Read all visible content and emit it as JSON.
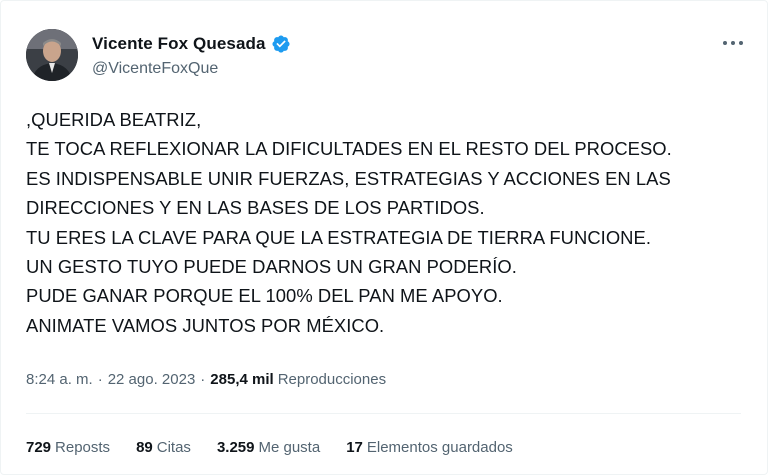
{
  "author": {
    "display_name": "Vicente Fox Quesada",
    "handle": "@VicenteFoxQue",
    "verified_icon": "verified-badge-icon",
    "avatar_icon": "avatar"
  },
  "menu": {
    "icon": "more-options-icon"
  },
  "tweet": {
    "lines": [
      ",QUERIDA BEATRIZ,",
      "TE TOCA REFLEXIONAR LA DIFICULTADES EN EL RESTO DEL PROCESO.",
      "ES INDISPENSABLE UNIR FUERZAS, ESTRATEGIAS Y ACCIONES EN LAS",
      "DIRECCIONES Y EN LAS BASES DE LOS PARTIDOS.",
      "TU ERES LA CLAVE PARA QUE LA ESTRATEGIA DE TIERRA FUNCIONE.",
      "UN GESTO TUYO PUEDE DARNOS UN GRAN PODERÍO.",
      "PUDE GANAR PORQUE EL 100% DEL PAN ME APOYO.",
      "ANIMATE VAMOS JUNTOS POR MÉXICO."
    ]
  },
  "meta": {
    "time": "8:24 a. m.",
    "separator": "·",
    "date": "22 ago. 2023",
    "views_count": "285,4 mil",
    "views_label": "Reproducciones"
  },
  "stats": {
    "reposts_count": "729",
    "reposts_label": "Reposts",
    "quotes_count": "89",
    "quotes_label": "Citas",
    "likes_count": "3.259",
    "likes_label": "Me gusta",
    "bookmarks_count": "17",
    "bookmarks_label": "Elementos guardados"
  },
  "colors": {
    "text_primary": "#0f1419",
    "text_secondary": "#536471",
    "verified_blue": "#1d9bf0",
    "divider": "#eff3f4"
  }
}
